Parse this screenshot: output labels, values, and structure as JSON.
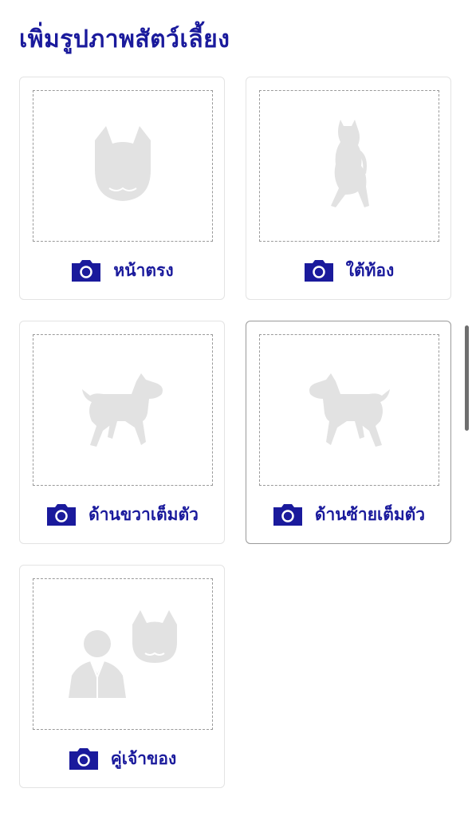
{
  "page": {
    "title": "เพิ่มรูปภาพสัตว์เลี้ยง"
  },
  "photo_slots": [
    {
      "label": "หน้าตรง",
      "silhouette": "dog-face-front",
      "selected": false
    },
    {
      "label": "ใต้ท้อง",
      "silhouette": "dog-standing-upright",
      "selected": false
    },
    {
      "label": "ด้านขวาเต็มตัว",
      "silhouette": "dog-full-body-right",
      "selected": false
    },
    {
      "label": "ด้านซ้ายเต็มตัว",
      "silhouette": "dog-full-body-left",
      "selected": true
    },
    {
      "label": "คู่เจ้าของ",
      "silhouette": "owner-with-dog",
      "selected": false
    }
  ],
  "icons": {
    "camera": "camera-icon"
  },
  "colors": {
    "accent": "#1a1a9c",
    "silhouette": "#e2e2e2",
    "dashed_border": "#9a9a9a",
    "card_border": "#e3e3e3",
    "selected_border": "#9a9a9a"
  }
}
